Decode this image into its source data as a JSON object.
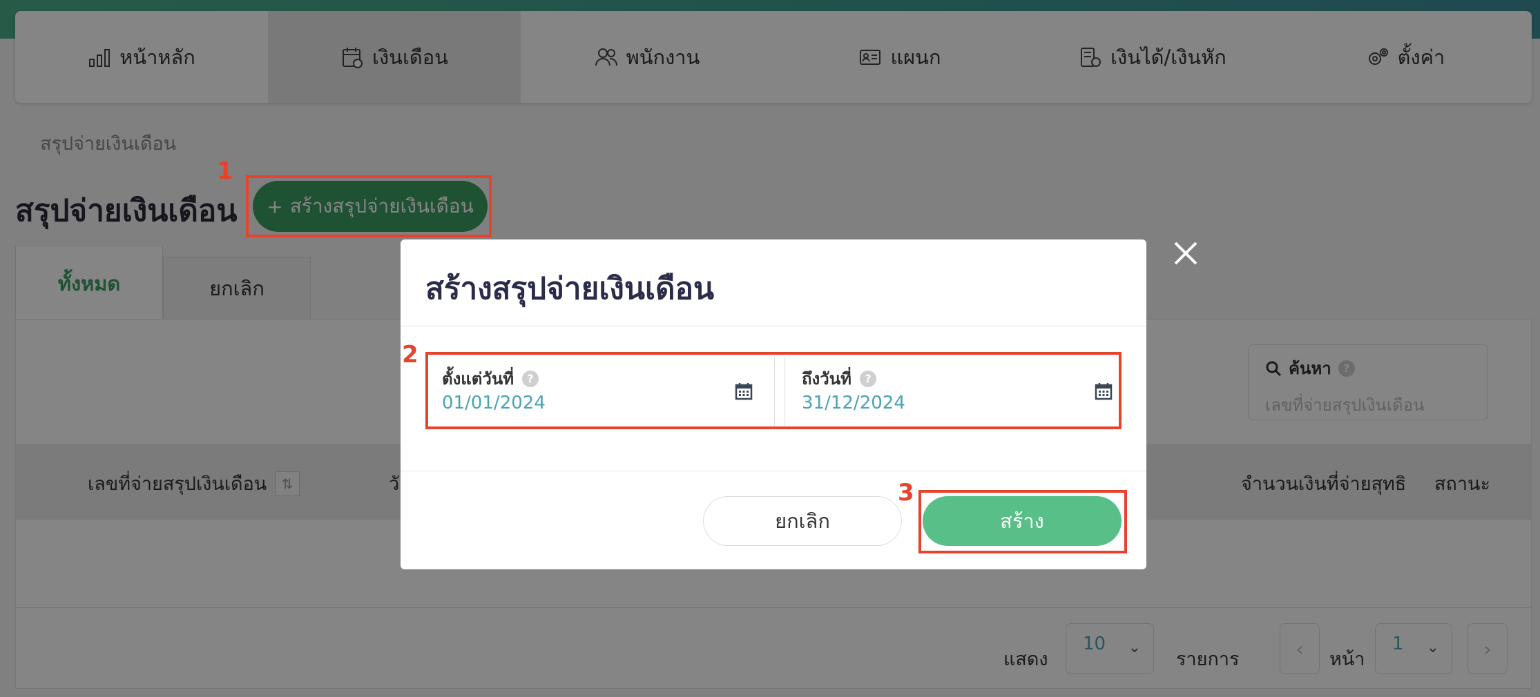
{
  "nav": {
    "items": [
      {
        "label": "หน้าหลัก",
        "icon": "bar-chart-icon"
      },
      {
        "label": "เงินเดือน",
        "icon": "calendar-icon"
      },
      {
        "label": "พนักงาน",
        "icon": "users-icon"
      },
      {
        "label": "แผนก",
        "icon": "id-card-icon"
      },
      {
        "label": "เงินได้/เงินหัก",
        "icon": "coins-icon"
      },
      {
        "label": "ตั้งค่า",
        "icon": "gears-icon"
      }
    ],
    "active_index": 1
  },
  "breadcrumb": "สรุปจ่ายเงินเดือน",
  "page": {
    "title": "สรุปจ่ายเงินเดือน",
    "create_button": "สร้างสรุปจ่ายเงินเดือน",
    "create_button_prefix": "+"
  },
  "tabs": [
    "ทั้งหมด",
    "ยกเลิก"
  ],
  "search": {
    "label": "ค้นหา",
    "placeholder": "เลขที่จ่ายสรุปเงินเดือน"
  },
  "table": {
    "headers": {
      "number": "เลขที่จ่ายสรุปเงินเดือน",
      "date_partial": "วั",
      "amount": "จำนวนเงินที่จ่ายสุทธิ",
      "status": "สถานะ"
    }
  },
  "pagination": {
    "show_label": "แสดง",
    "page_size": "10",
    "items_label": "รายการ",
    "page_label": "หน้า",
    "page": "1"
  },
  "modal": {
    "title": "สร้างสรุปจ่ายเงินเดือน",
    "from_label": "ตั้งแต่วันที่",
    "from_value": "01/01/2024",
    "to_label": "ถึงวันที่",
    "to_value": "31/12/2024",
    "cancel": "ยกเลิก",
    "submit": "สร้าง"
  },
  "annotations": {
    "one": "1",
    "two": "2",
    "three": "3"
  },
  "colors": {
    "brand_green": "#3d9b63",
    "submit_green": "#57bf87",
    "highlight_red": "#e8412c",
    "date_teal": "#4aa3b5"
  }
}
